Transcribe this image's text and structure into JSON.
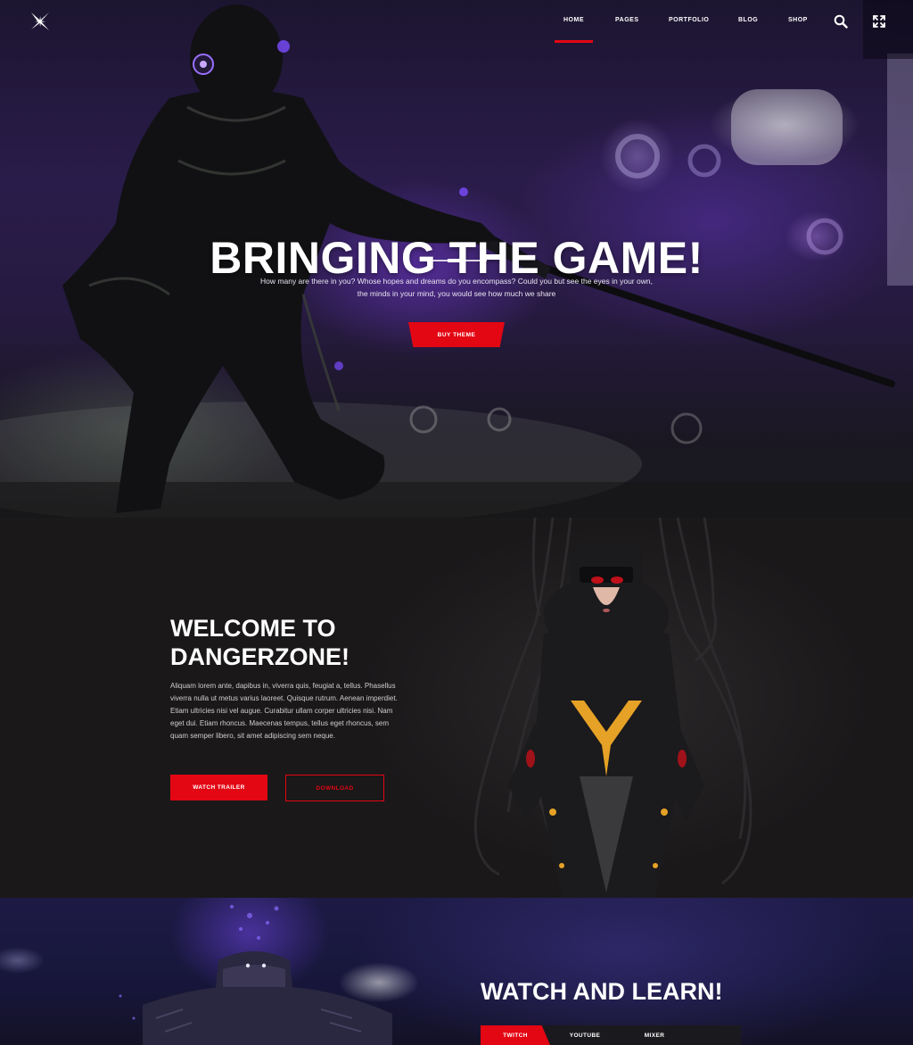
{
  "colors": {
    "accent": "#e30613",
    "hero_bg": "#2a1c4a",
    "section_bg": "#1a1819"
  },
  "nav": {
    "logo_icon": "x-star-logo-icon",
    "items": [
      {
        "label": "HOME",
        "active": true
      },
      {
        "label": "PAGES",
        "active": false
      },
      {
        "label": "PORTFOLIO",
        "active": false
      },
      {
        "label": "BLOG",
        "active": false
      },
      {
        "label": "SHOP",
        "active": false
      }
    ],
    "search_icon": "search-icon",
    "fullscreen_icon": "fullscreen-icon"
  },
  "hero": {
    "title": "BRINGING THE GAME!",
    "subtitle_line1": "How many are there in you? Whose hopes and dreams do you encompass? Could you but see the eyes in your own,",
    "subtitle_line2": "the minds in your mind, you would see how much we share",
    "button_label": "BUY THEME"
  },
  "welcome": {
    "title_line1": "WELCOME TO",
    "title_line2": "DANGERZONE!",
    "body": "Aliquam lorem ante, dapibus in, viverra quis, feugiat a, tellus. Phasellus viverra nulla ut metus varius laoreet. Quisque rutrum. Aenean imperdiet. Etiam ultricies nisi vel augue. Curabitur ullam corper ultricies nisi. Nam eget dui. Etiam rhoncus. Maecenas tempus, tellus eget rhoncus, sem quam semper libero, sit amet adipiscing sem neque.",
    "trailer_label": "WATCH TRAILER",
    "download_label": "DOWNLOAD"
  },
  "watch": {
    "title": "WATCH AND LEARN!",
    "tabs": [
      {
        "label": "TWITCH",
        "active": true
      },
      {
        "label": "YOUTUBE",
        "active": false
      },
      {
        "label": "MIXER",
        "active": false
      }
    ]
  }
}
